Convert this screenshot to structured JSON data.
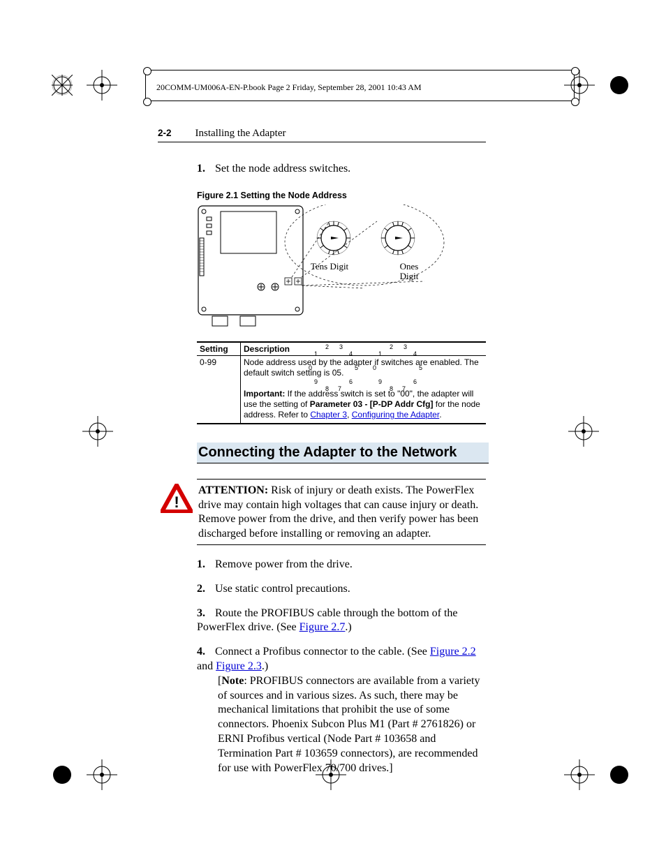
{
  "meta": {
    "book_line": "20COMM-UM006A-EN-P.book  Page 2  Friday, September 28, 2001  10:43 AM"
  },
  "header": {
    "page_num": "2-2",
    "chapter_title": "Installing the Adapter"
  },
  "intro_step": {
    "n": "1.",
    "text": "Set the node address switches."
  },
  "figure": {
    "caption": "Figure 2.1   Setting the Node Address",
    "tens_label": "Tens Digit",
    "ones_label": "Ones Digit",
    "dial_nums": [
      "0",
      "1",
      "2",
      "3",
      "4",
      "5",
      "6",
      "7",
      "8",
      "9"
    ]
  },
  "table": {
    "head_setting": "Setting",
    "head_desc": "Description",
    "row": {
      "setting": "0-99",
      "desc1": "Node address used by the adapter if switches are enabled. The default switch setting is 05.",
      "imp_label": "Important:",
      "imp_text_a": " If the address switch is set to \"00\", the adapter will use the setting of ",
      "param": "Parameter 03 - [P-DP Addr Cfg]",
      "imp_text_b": " for the node address. Refer to ",
      "link1": "Chapter 3",
      "comma": ", ",
      "link2": "Configuring the Adapter",
      "period": "."
    }
  },
  "section_heading": "Connecting the Adapter to the Network",
  "attention": {
    "label": "ATTENTION:",
    "text": "  Risk of injury or death exists. The PowerFlex drive may contain high voltages that can cause injury or death. Remove power from the drive, and then verify power has been discharged before installing or removing an adapter."
  },
  "steps2": [
    {
      "n": "1.",
      "body": "Remove power from the drive."
    },
    {
      "n": "2.",
      "body": "Use static control precautions."
    },
    {
      "n": "3.",
      "body_pre": "Route the PROFIBUS cable through the bottom of the PowerFlex drive. (See ",
      "link": "Figure 2.7",
      "body_post": ".)"
    },
    {
      "n": "4.",
      "body_pre": "Connect a Profibus connector to the cable. (See ",
      "link1": "Figure 2.2",
      "mid": " and ",
      "link2": "Figure 2.3",
      "body_post": ".)",
      "note_label": "Note",
      "note": "[",
      "note_text": ": PROFIBUS connectors are available from a variety of sources and in various sizes. As such, there may be mechanical limitations that prohibit the use of some connectors. Phoenix Subcon Plus M1 (Part # 2761826) or ERNI Profibus vertical (Node Part # 103658 and Termination Part # 103659 connectors), are recommended for use with PowerFlex 70/700 drives.]"
    }
  ]
}
